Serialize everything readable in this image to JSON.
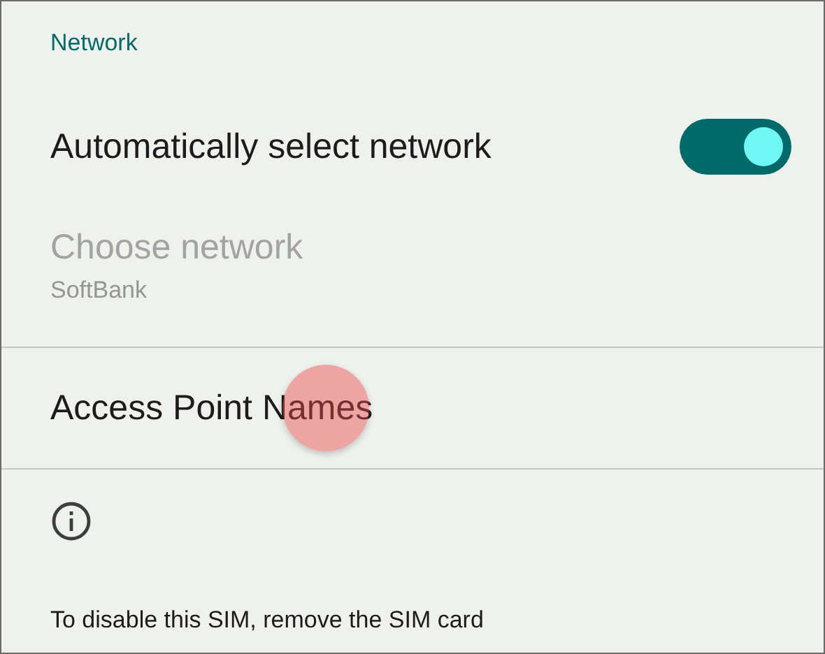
{
  "section": {
    "title": "Network"
  },
  "rows": [
    {
      "kind": "toggle",
      "title": "Automatically select network",
      "on": true
    },
    {
      "kind": "disabled",
      "title": "Choose network",
      "summary": "SoftBank"
    },
    {
      "kind": "plain",
      "title": "Access Point Names",
      "touched": true
    }
  ],
  "footer": {
    "text": "To disable this SIM, remove the SIM card"
  }
}
